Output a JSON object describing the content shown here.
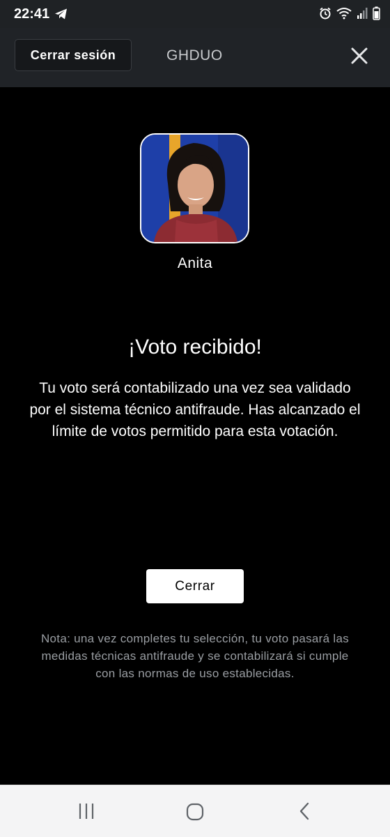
{
  "status_bar": {
    "time": "22:41",
    "icons": [
      "telegram-icon",
      "alarm-icon",
      "wifi-icon",
      "signal-icon",
      "battery-icon"
    ]
  },
  "header": {
    "logout_label": "Cerrar sesión",
    "title": "GHDUO",
    "close_icon": "close-icon"
  },
  "candidate": {
    "name": "Anita"
  },
  "confirmation": {
    "title": "¡Voto recibido!",
    "message": "Tu voto será contabilizado una vez sea validado por el sistema técnico antifraude. Has alcanzado el límite de votos permitido para esta votación.",
    "close_label": "Cerrar",
    "note": "Nota: una vez completes tu selección, tu voto pasará las medidas técnicas antifraude y se contabilizará si cumple con las normas de uso establecidas."
  },
  "nav_bar": {
    "icons": [
      "recent-apps-icon",
      "home-icon",
      "back-icon"
    ]
  },
  "colors": {
    "background": "#000000",
    "header": "#202327",
    "status_bar": "#1f2225",
    "note_text": "#9a9ea3",
    "photo_background": "#1e3fa8",
    "photo_accent": "#e8a52a"
  }
}
